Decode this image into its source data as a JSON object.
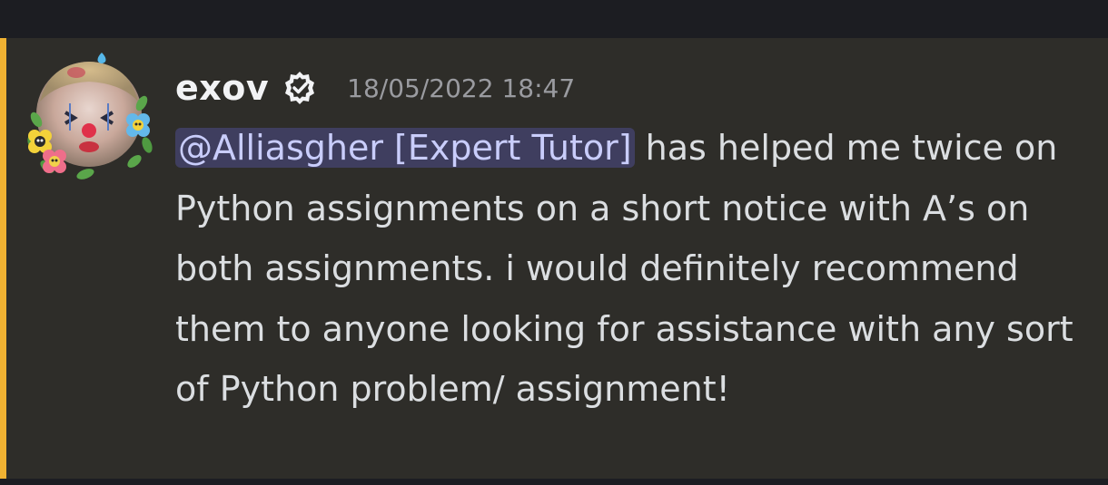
{
  "message": {
    "username": "exov",
    "timestamp": "18/05/2022 18:47",
    "mention": "@Alliasgher [Expert Tutor]",
    "body": " has helped me twice on Python assignments on a short notice with A’s on both assignments. i would definitely recommend them to anyone looking for assistance with any sort of Python problem/ assignment!",
    "icons": {
      "avatar": "clown-avatar-with-flowers",
      "badge": "verified-check-icon"
    }
  },
  "colors": {
    "mention_bar": "#f0b232",
    "mention_bg": "#3f3e5f",
    "mention_text": "#c9cdfb",
    "message_bg": "#2e2d29"
  }
}
